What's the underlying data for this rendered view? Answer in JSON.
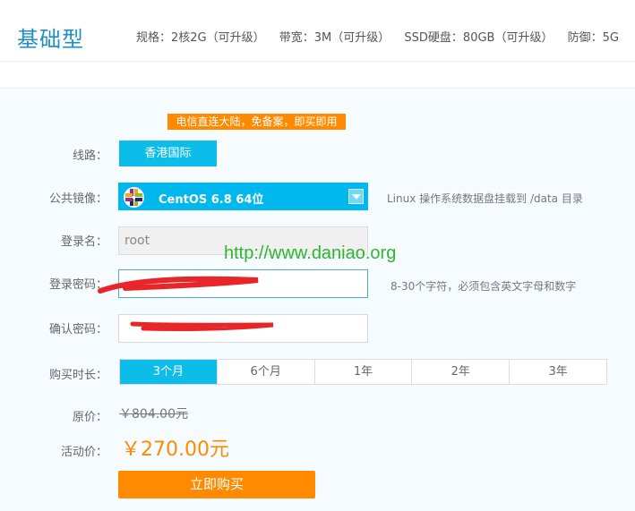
{
  "header": {
    "plan_name": "基础型",
    "specs": [
      "规格：2核2G（可升级）",
      "带宽：3M（可升级）",
      "SSD硬盘：80GB（可升级）",
      "防御：5G"
    ]
  },
  "form": {
    "promo_badge": "电信直连大陆，免备案，即买即用",
    "line_label": "线路：",
    "line_value": "香港国际",
    "image_label": "公共镜像：",
    "image_value": "CentOS 6.8 64位",
    "image_icon": "centos-logo-icon",
    "image_hint": "Linux 操作系统数据盘挂载到 /data 目录",
    "login_label": "登录名：",
    "login_value": "root",
    "password_label": "登录密码：",
    "password_hint": "8-30个字符，必须包含英文字母和数字",
    "confirm_label": "确认密码：",
    "duration_label": "购买时长：",
    "duration_options": [
      "3个月",
      "6个月",
      "1年",
      "2年",
      "3年"
    ],
    "selected_duration": "3个月",
    "orig_price_label": "原价：",
    "orig_price": "￥804.00元",
    "sale_price_label": "活动价：",
    "sale_price": "￥270.00元",
    "buy_button": "立即购买"
  },
  "watermark": "http://www.daniao.org",
  "colors": {
    "accent_blue": "#0bbde8",
    "accent_orange": "#ff8a00",
    "watermark_green": "#30b531",
    "redaction_red": "#e8262a"
  }
}
